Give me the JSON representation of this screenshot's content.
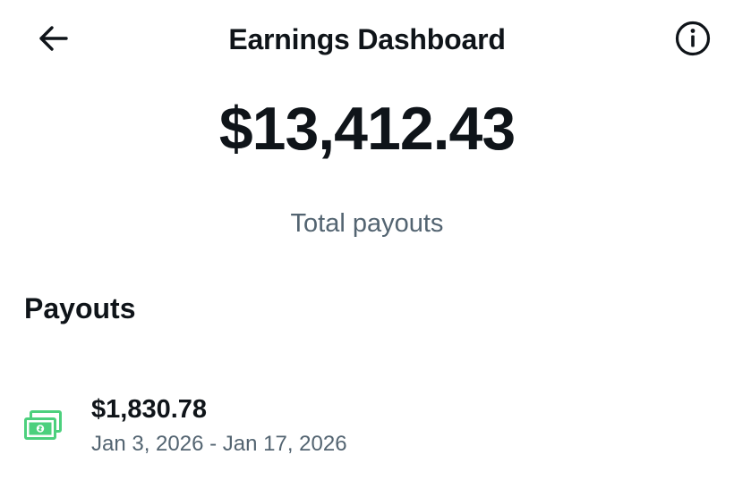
{
  "header": {
    "title": "Earnings Dashboard",
    "back_icon": "arrow-left-icon",
    "info_icon": "info-circle-icon"
  },
  "summary": {
    "total_amount": "$13,412.43",
    "total_label": "Total payouts"
  },
  "payouts": {
    "heading": "Payouts",
    "items": [
      {
        "icon": "money-bills-icon",
        "amount": "$1,830.78",
        "date_range": "Jan 3, 2026 - Jan 17, 2026"
      }
    ]
  },
  "colors": {
    "text_primary": "#0f1419",
    "text_secondary": "#536471",
    "money_icon": "#4cd07d"
  }
}
